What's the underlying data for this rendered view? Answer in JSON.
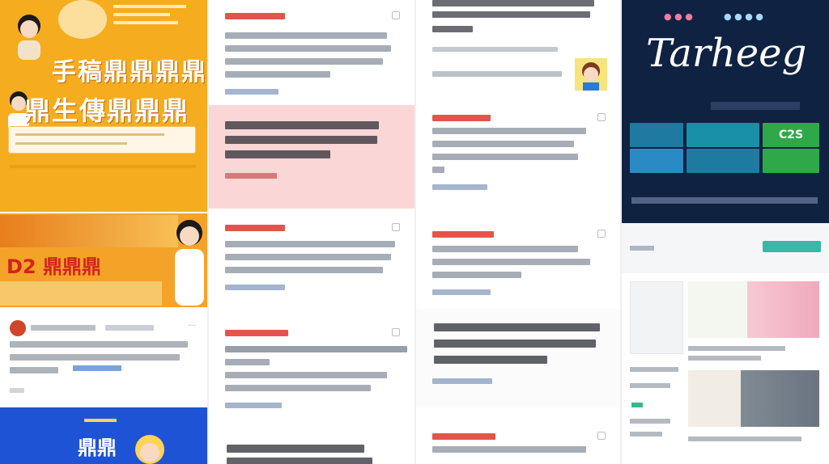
{
  "posters": {
    "orange_top": {
      "line1": "手稿鼎鼎鼎鼎",
      "line2": "鼎生傳鼎鼎鼎"
    },
    "orange_mid": {
      "title": "D2 鼎鼎鼎"
    },
    "blue_bottom": {
      "title": "鼎鼎"
    }
  },
  "feed": {
    "more_icon": "more-dots-icon"
  },
  "right_panel": {
    "logo_text": "Tarheeg",
    "tiles": [
      "",
      "",
      "C2S",
      "",
      "",
      ""
    ]
  },
  "colors": {
    "orange": "#f6ac1f",
    "navy": "#0f2241",
    "pink": "#fbd6d6",
    "accent_red": "#e3554a",
    "link_blue": "#8fa3c0",
    "blue": "#1f53d6"
  }
}
